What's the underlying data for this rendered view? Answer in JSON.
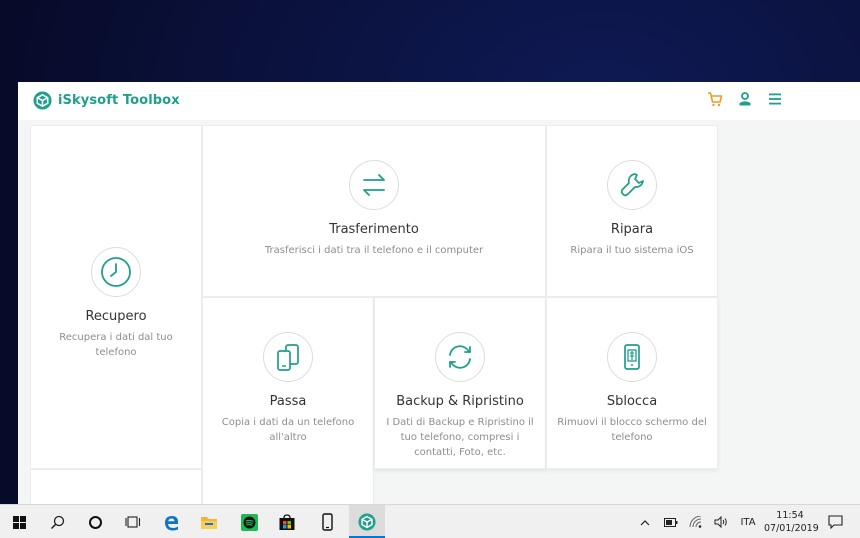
{
  "app": {
    "name": "iSkysoft Toolbox",
    "accent": "#1f9f8c",
    "cart_color": "#f29a1e"
  },
  "cards": {
    "recupero": {
      "title": "Recupero",
      "desc": [
        "Recupera i dati dal tuo",
        "telefono"
      ]
    },
    "trasferimento": {
      "title": "Trasferimento",
      "desc": [
        "Trasferisci i dati tra il telefono e il computer"
      ]
    },
    "ripara": {
      "title": "Ripara",
      "desc": [
        "Ripara il tuo sistema iOS"
      ]
    },
    "passa": {
      "title": "Passa",
      "desc": [
        "Copia i dati da un telefono",
        "all'altro"
      ]
    },
    "backup": {
      "title": "Backup & Ripristino",
      "desc": [
        "I Dati di Backup e Ripristino il",
        "tuo telefono, compresi i",
        "contatti, Foto, etc."
      ]
    },
    "sblocca": {
      "title": "Sblocca",
      "desc": [
        "Rimuovi il blocco schermo del",
        "telefono"
      ]
    }
  },
  "taskbar": {
    "language": "ITA",
    "time": "11:54",
    "date": "07/01/2019"
  },
  "icons": [
    "start-icon",
    "search-icon",
    "cortana-icon",
    "task-view-icon",
    "edge-icon",
    "file-explorer-icon",
    "spotify-icon",
    "store-icon",
    "phone-icon",
    "iskysoft-taskbar-icon",
    "chevron-up-icon",
    "battery-icon",
    "wifi-icon",
    "volume-icon",
    "notification-icon"
  ]
}
